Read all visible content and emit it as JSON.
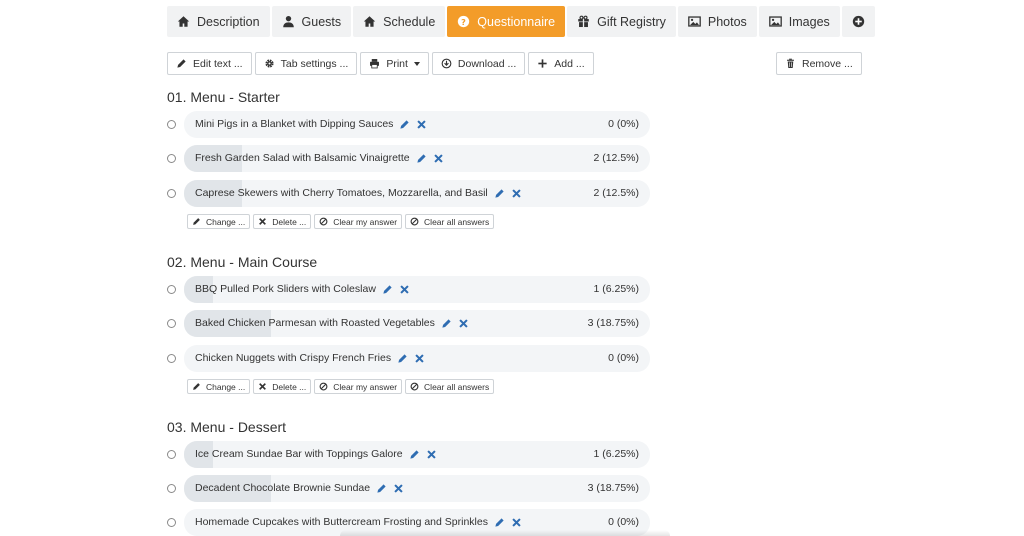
{
  "tabs": [
    {
      "label": "Description",
      "icon": "home-icon"
    },
    {
      "label": "Guests",
      "icon": "user-icon"
    },
    {
      "label": "Schedule",
      "icon": "home-icon"
    },
    {
      "label": "Questionnaire",
      "icon": "question-circle-icon",
      "active": true
    },
    {
      "label": "Gift Registry",
      "icon": "gift-icon"
    },
    {
      "label": "Photos",
      "icon": "image-icon"
    },
    {
      "label": "Images",
      "icon": "image-icon"
    },
    {
      "label": "",
      "icon": "plus-circle-icon"
    }
  ],
  "toolbar": {
    "edit_text": "Edit text ...",
    "tab_settings": "Tab settings ...",
    "print": "Print",
    "download": "Download ...",
    "add": "Add ...",
    "remove": "Remove ..."
  },
  "colors": {
    "accent": "#f39c29",
    "icon_blue": "#2f6db2",
    "pill_bg": "#f3f5f7",
    "pill_fill": "#e1e5e9"
  },
  "sections": [
    {
      "title": "01. Menu - Starter",
      "options": [
        {
          "label": "Mini Pigs in a Blanket with Dipping Sauces",
          "count": "0 (0%)",
          "fraction": 0
        },
        {
          "label": "Fresh Garden Salad with Balsamic Vinaigrette",
          "count": "2 (12.5%)",
          "fraction": 0.125
        },
        {
          "label": "Caprese Skewers with Cherry Tomatoes, Mozzarella, and Basil",
          "count": "2 (12.5%)",
          "fraction": 0.125
        }
      ],
      "actions": {
        "change": "Change ...",
        "delete": "Delete ...",
        "clear_my": "Clear my answer",
        "clear_all": "Clear all answers"
      }
    },
    {
      "title": "02. Menu - Main Course",
      "options": [
        {
          "label": "BBQ Pulled Pork Sliders with Coleslaw",
          "count": "1 (6.25%)",
          "fraction": 0.0625
        },
        {
          "label": "Baked Chicken Parmesan with Roasted Vegetables",
          "count": "3 (18.75%)",
          "fraction": 0.1875
        },
        {
          "label": "Chicken Nuggets with Crispy French Fries",
          "count": "0 (0%)",
          "fraction": 0
        }
      ],
      "actions": {
        "change": "Change ...",
        "delete": "Delete ...",
        "clear_my": "Clear my answer",
        "clear_all": "Clear all answers"
      }
    },
    {
      "title": "03. Menu - Dessert",
      "options": [
        {
          "label": "Ice Cream Sundae Bar with Toppings Galore",
          "count": "1 (6.25%)",
          "fraction": 0.0625
        },
        {
          "label": "Decadent Chocolate Brownie Sundae",
          "count": "3 (18.75%)",
          "fraction": 0.1875
        },
        {
          "label": "Homemade Cupcakes with Buttercream Frosting and Sprinkles",
          "count": "0 (0%)",
          "fraction": 0
        }
      ]
    }
  ]
}
